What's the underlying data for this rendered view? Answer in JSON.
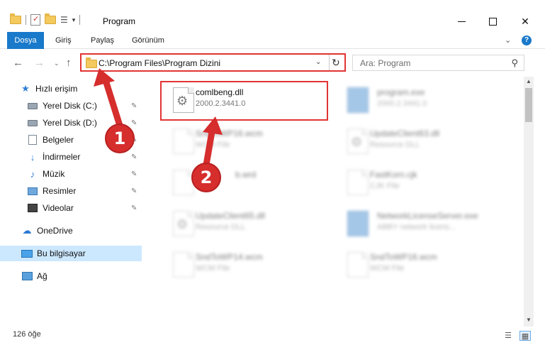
{
  "window": {
    "title": "Program",
    "minimize_icon": "minimize-icon",
    "maximize_icon": "maximize-icon",
    "close_glyph": "✕"
  },
  "ribbon": {
    "tabs": [
      "Dosya",
      "Giriş",
      "Paylaş",
      "Görünüm"
    ],
    "help_glyph": "?",
    "chevron_glyph": "⌄"
  },
  "nav": {
    "back_glyph": "←",
    "forward_glyph": "→",
    "recent_glyph": "⌄",
    "up_glyph": "↑"
  },
  "address": {
    "path": "C:\\Program Files\\Program Dizini",
    "dropdown_glyph": "⌄",
    "refresh_glyph": "↻"
  },
  "search": {
    "placeholder": "Ara: Program",
    "icon_glyph": "⚲"
  },
  "sidebar": {
    "items": [
      {
        "label": "Hızlı erişim",
        "icon": "star-icon"
      },
      {
        "label": "Yerel Disk (C:)",
        "icon": "disk-icon",
        "pinned": true
      },
      {
        "label": "Yerel Disk (D:)",
        "icon": "disk-icon",
        "pinned": true
      },
      {
        "label": "Belgeler",
        "icon": "document-icon",
        "pinned": true
      },
      {
        "label": "İndirmeler",
        "icon": "download-icon",
        "pinned": true
      },
      {
        "label": "Müzik",
        "icon": "music-icon",
        "pinned": true
      },
      {
        "label": "Resimler",
        "icon": "pictures-icon",
        "pinned": true
      },
      {
        "label": "Videolar",
        "icon": "videos-icon",
        "pinned": true
      },
      {
        "label": "OneDrive",
        "icon": "cloud-icon"
      },
      {
        "label": "Bu bilgisayar",
        "icon": "computer-icon",
        "selected": true
      },
      {
        "label": "Ağ",
        "icon": "network-icon"
      }
    ],
    "pin_glyph": "📌"
  },
  "files": [
    {
      "name": "comlbeng.dll",
      "sub": "2000.2.3441.0",
      "icon": "dll-file-icon"
    },
    {
      "name": "program.exe",
      "sub": "2000.2.3441.0",
      "icon": "exe-file-icon"
    },
    {
      "name": "SndToWP16.wcm",
      "sub": "WCM File",
      "icon": "file-icon"
    },
    {
      "name": "UpdateClient63.dll",
      "sub": "Resource DLL",
      "icon": "dll-file-icon"
    },
    {
      "name": "b.wrd",
      "sub": "",
      "icon": "file-icon"
    },
    {
      "name": "FastKorn.cjk",
      "sub": "CJK File",
      "icon": "file-icon"
    },
    {
      "name": "UpdateClient65.dll",
      "sub": "Resource DLL",
      "icon": "dll-file-icon"
    },
    {
      "name": "NetworkLicenseServer.exe",
      "sub": "ABBY network licens...",
      "icon": "exe-file-icon"
    },
    {
      "name": "SndToWP14.wcm",
      "sub": "WCM File",
      "icon": "file-icon"
    },
    {
      "name": "SndToWP16.wcm",
      "sub": "WCM File",
      "icon": "file-icon"
    }
  ],
  "status": {
    "count": "126 öğe"
  },
  "callouts": [
    "1",
    "2"
  ],
  "colors": {
    "accent": "#1979ca",
    "highlight": "#e23434",
    "callout": "#d62d2d",
    "selection": "#cce8ff"
  }
}
